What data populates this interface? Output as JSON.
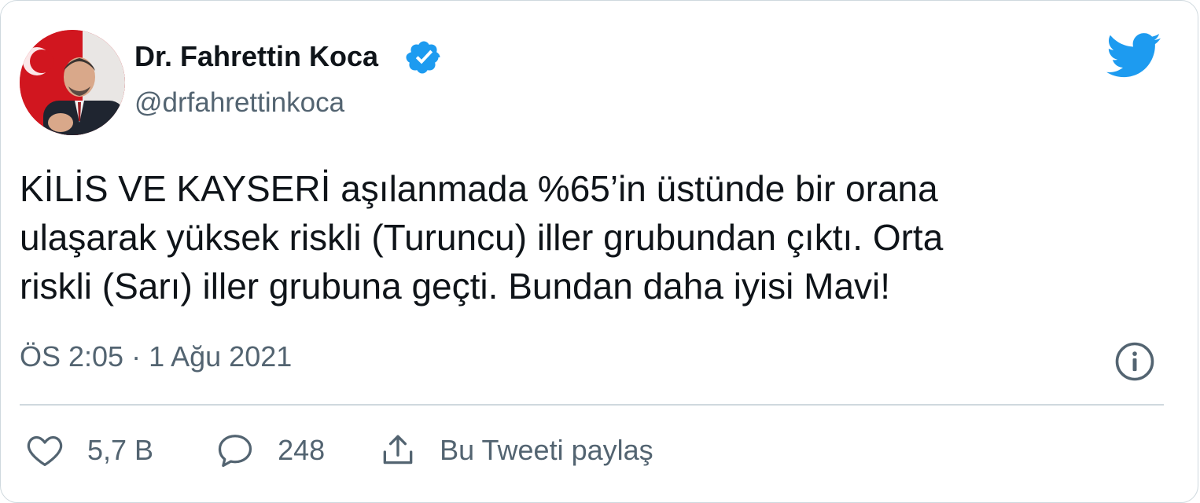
{
  "author": {
    "name": "Dr. Fahrettin Koca",
    "handle": "@drfahrettinkoca",
    "verified": true
  },
  "tweet": {
    "text": "KİLİS VE KAYSERİ aşılanmada %65’in üstünde bir orana\nulaşarak yüksek riskli (Turuncu) iller grubundan çıktı. Orta\nriskli (Sarı) iller grubuna geçti. Bundan daha iyisi Mavi!",
    "timestamp": "ÖS 2:05 · 1 Ağu 2021"
  },
  "actions": {
    "like_count": "5,7 B",
    "reply_count": "248",
    "share_label": "Bu Tweeti paylaş"
  },
  "icons": {
    "like": "heart-icon",
    "reply": "speech-bubble-icon",
    "share": "share-upload-icon",
    "info": "info-icon",
    "brand": "twitter-bird-icon",
    "verified": "verified-badge-icon"
  },
  "colors": {
    "brand": "#1d9bf0",
    "text_primary": "#0f1419",
    "text_secondary": "#536471",
    "border": "#cfd9de"
  }
}
